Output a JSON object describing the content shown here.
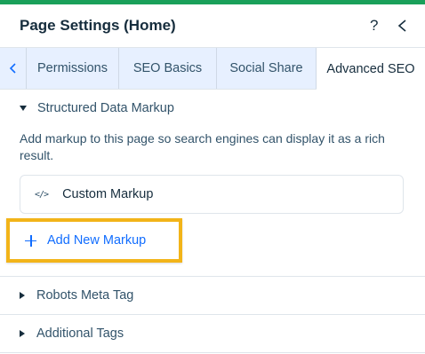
{
  "header": {
    "title": "Page Settings (Home)",
    "help_label": "?",
    "accent_color": "#1aa05a"
  },
  "tabs": [
    {
      "label": "Permissions",
      "active": false
    },
    {
      "label": "SEO Basics",
      "active": false
    },
    {
      "label": "Social Share",
      "active": false
    },
    {
      "label": "Advanced SEO",
      "active": true
    }
  ],
  "structured_data": {
    "heading": "Structured Data Markup",
    "expanded": true,
    "description": "Add markup to this page so search engines can display it as a rich result.",
    "markups": [
      {
        "label": "Custom Markup",
        "icon": "code-icon"
      }
    ],
    "add_button_label": "Add New Markup",
    "highlight_color": "#f2b419",
    "link_color": "#116dff"
  },
  "robots": {
    "heading": "Robots Meta Tag",
    "expanded": false
  },
  "additional": {
    "heading": "Additional Tags",
    "expanded": false
  }
}
